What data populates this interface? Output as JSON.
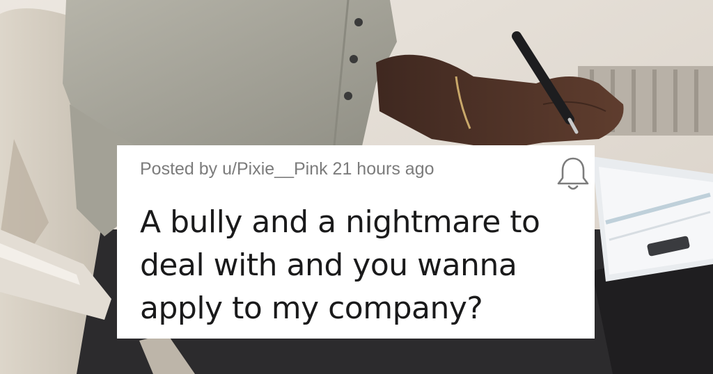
{
  "post": {
    "meta": "Posted by u/Pixie__Pink 21 hours ago",
    "title": "A bully and a nightmare to deal with and you wanna apply to my company?"
  },
  "icons": {
    "notification": "bell-icon"
  },
  "colors": {
    "card_background": "#ffffff",
    "meta_text": "#7c7c7c",
    "title_text": "#1a1a1b",
    "sweater": "#a7a69b",
    "skin": "#4a2f24",
    "pen": "#1d1d1f"
  }
}
